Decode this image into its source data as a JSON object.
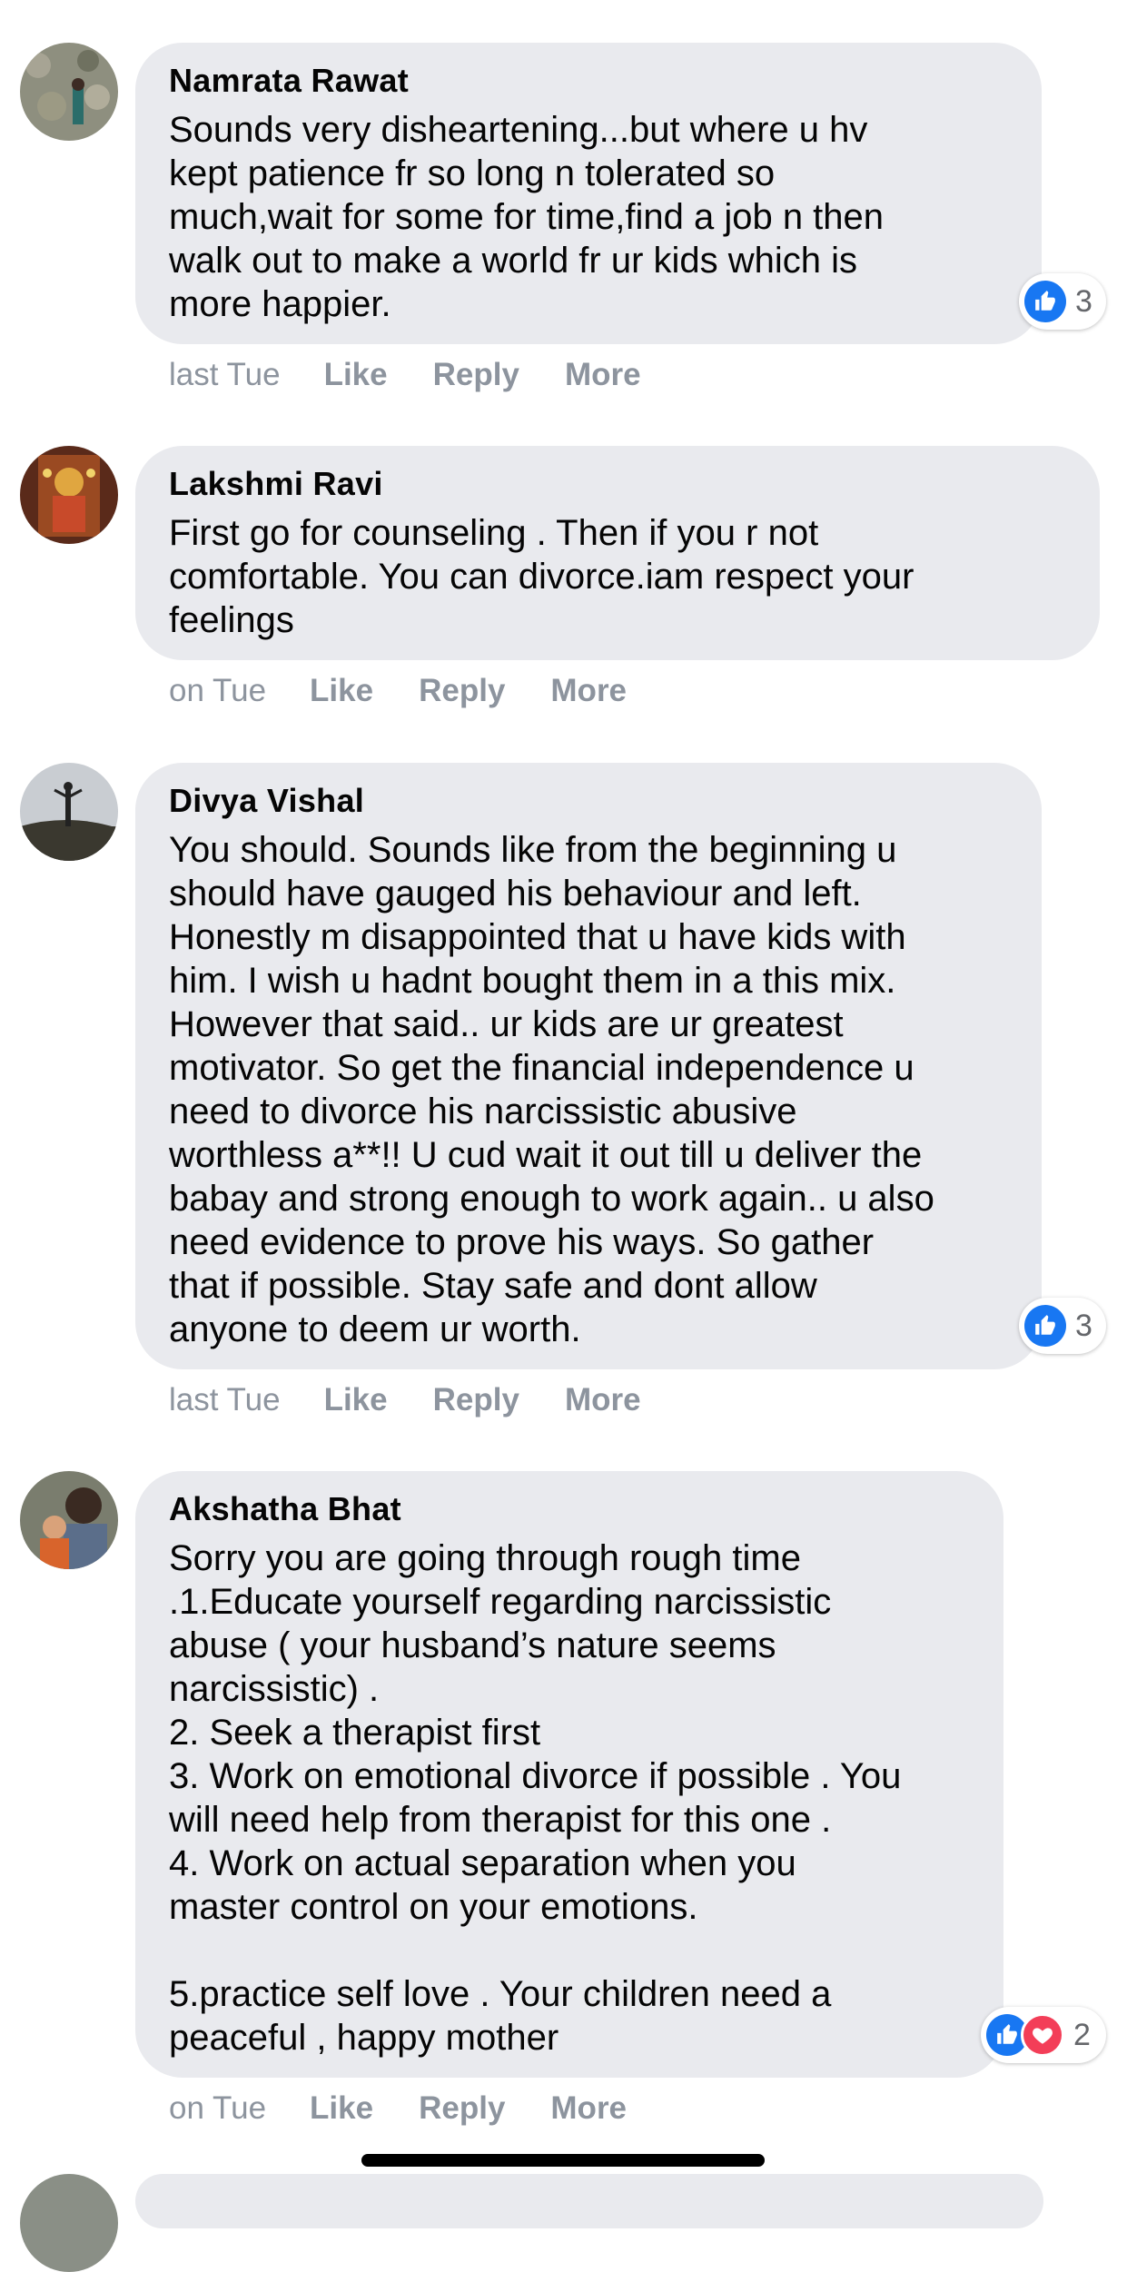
{
  "comments": [
    {
      "author": "Namrata Rawat",
      "text": "Sounds very disheartening...but where u hv\nkept patience fr so long n tolerated so\nmuch,wait for some for time,find a job n then\nwalk out to make a world fr ur kids which is\nmore happier.",
      "time": "last Tue",
      "like": "Like",
      "reply": "Reply",
      "more": "More",
      "reaction_count": "3"
    },
    {
      "author": "Lakshmi Ravi",
      "text": "First go for counseling . Then if you r not\ncomfortable. You can divorce.iam respect your\nfeelings",
      "time": "on Tue",
      "like": "Like",
      "reply": "Reply",
      "more": "More"
    },
    {
      "author": "Divya Vishal",
      "text": "You should. Sounds like from the beginning u\nshould have gauged his behaviour and left.\nHonestly m disappointed that u have kids with\nhim. I wish u hadnt bought them in a this mix.\nHowever that said.. ur kids are ur greatest\nmotivator. So get the financial independence u\nneed to divorce his narcissistic abusive\nworthless a**!! U cud wait it out till u deliver the\nbabay and strong enough to work again.. u also\nneed evidence to prove his ways. So gather\nthat if possible. Stay safe and dont allow\nanyone to deem ur worth.",
      "time": "last Tue",
      "like": "Like",
      "reply": "Reply",
      "more": "More",
      "reaction_count": "3"
    },
    {
      "author": "Akshatha Bhat",
      "text": "Sorry you are going through rough time\n.1.Educate yourself regarding narcissistic\nabuse ( your husband’s nature seems\nnarcissistic) .\n2. Seek a therapist first\n3. Work on emotional divorce if possible . You\nwill need help from therapist for this one .\n4. Work on actual separation when you\nmaster control on your emotions.\n\n5.practice self love . Your children need a\npeaceful , happy mother",
      "time": "on Tue",
      "like": "Like",
      "reply": "Reply",
      "more": "More",
      "reaction_count": "2"
    }
  ],
  "icons": {
    "like": "thumbs-up-icon",
    "love": "heart-icon"
  },
  "colors": {
    "bubble": "#e9eaee",
    "like_blue": "#1877f2",
    "love_red": "#f33e58",
    "meta_gray": "#8d949e"
  }
}
